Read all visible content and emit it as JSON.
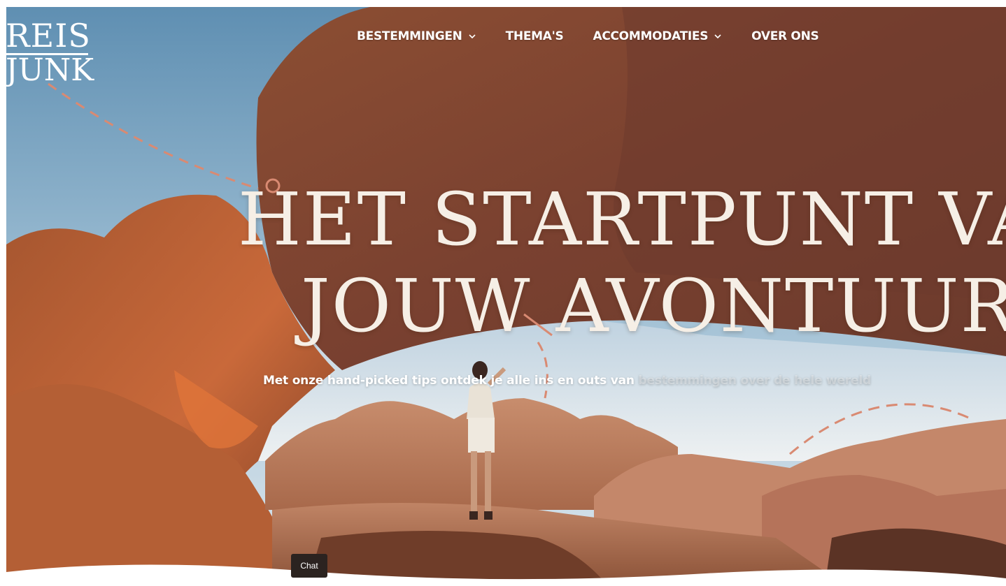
{
  "brand": {
    "logo_line1": "REIS",
    "logo_line2": "JUNK"
  },
  "nav": {
    "items": [
      {
        "label": "BESTEMMINGEN",
        "has_dropdown": true
      },
      {
        "label": "THEMA'S",
        "has_dropdown": false
      },
      {
        "label": "ACCOMMODATIES",
        "has_dropdown": true
      },
      {
        "label": "OVER ONS",
        "has_dropdown": false
      }
    ]
  },
  "hero": {
    "headline_line1": "HET STARTPUNT VAN",
    "headline_line2": "JOUW AVONTUUR",
    "subline_visible": "Met onze hand-picked tips ontdek je alle ins en outs van ",
    "subline_faded": "bestemmingen over de hele wereld",
    "image_description_icon": "desert-rock-arch-photo"
  },
  "chat": {
    "label": "Chat"
  },
  "colors": {
    "headline": "#f6efe6",
    "nav_text": "#ffffff",
    "chat_bg": "#2b2320",
    "dashed_line": "#d98a72",
    "sky": "#8fb3cc",
    "rock": "#b8643a"
  }
}
